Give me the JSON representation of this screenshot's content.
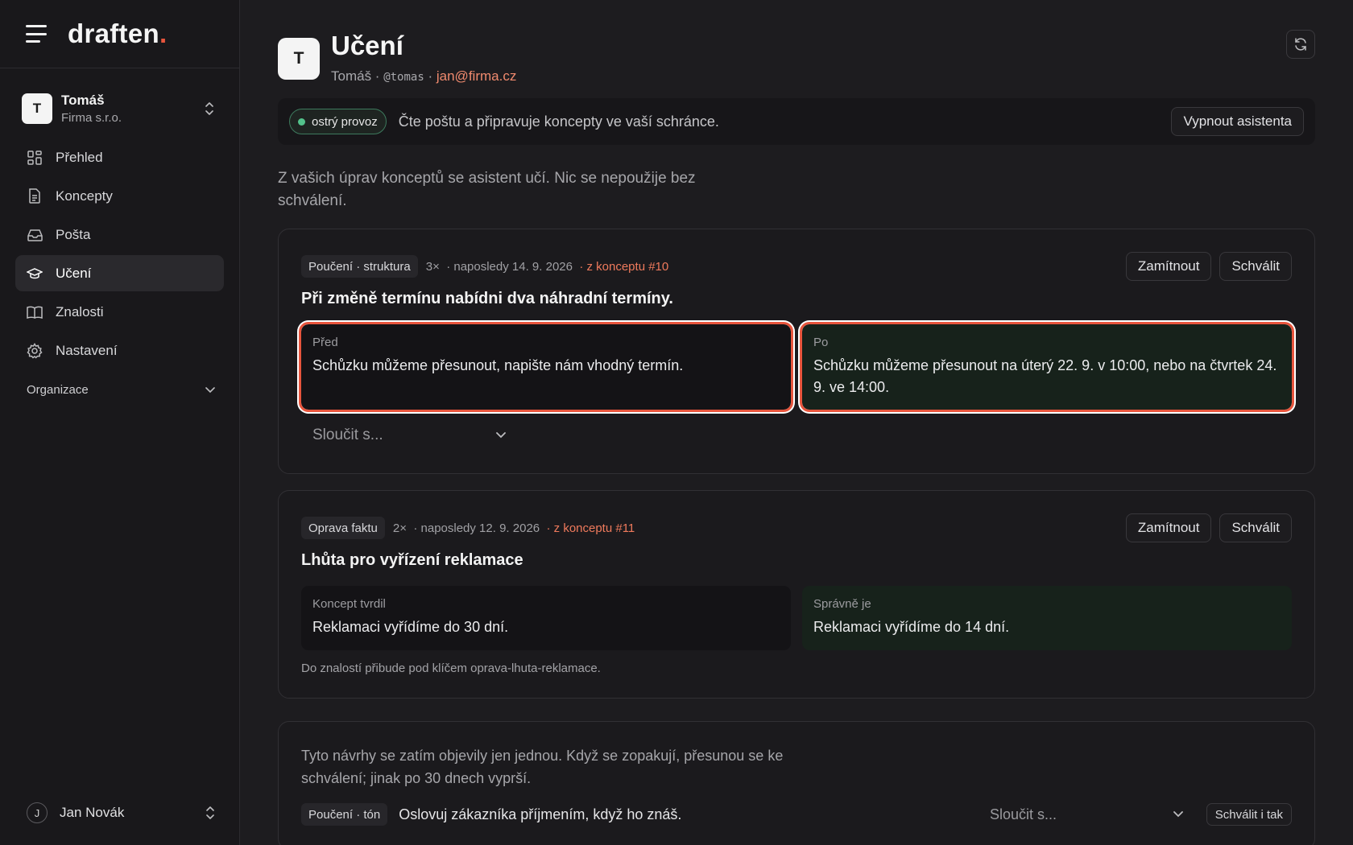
{
  "brand": {
    "name": "draften",
    "dot": "."
  },
  "workspace": {
    "initial": "T",
    "name": "Tomáš",
    "org": "Firma s.r.o."
  },
  "nav": [
    {
      "label": "Přehled",
      "icon": "dashboard-icon"
    },
    {
      "label": "Koncepty",
      "icon": "document-icon"
    },
    {
      "label": "Pošta",
      "icon": "inbox-icon"
    },
    {
      "label": "Učení",
      "icon": "graduation-cap-icon",
      "active": true
    },
    {
      "label": "Znalosti",
      "icon": "book-icon"
    },
    {
      "label": "Nastavení",
      "icon": "gear-icon"
    }
  ],
  "org_section": "Organizace",
  "user": {
    "initial": "J",
    "name": "Jan Novák"
  },
  "page": {
    "initial": "T",
    "title": "Učení",
    "name": "Tomáš",
    "handle": "@tomas",
    "email": "jan@firma.cz"
  },
  "status": {
    "pill": "ostrý provoz",
    "text": "Čte poštu a připravuje koncepty ve vaší schránce.",
    "button": "Vypnout asistenta"
  },
  "intro": "Z vašich úprav konceptů se asistent učí. Nic se nepoužije bez schválení.",
  "cards": [
    {
      "tag": "Poučení · struktura",
      "count": "3×",
      "last": "· naposledy 14. 9. 2026",
      "source": "· z konceptu #10",
      "title": "Při změně termínu nabídni dva náhradní termíny.",
      "left_label": "Před",
      "left_text": "Schůzku můžeme přesunout, napište nám vhodný termín.",
      "right_label": "Po",
      "right_text": "Schůzku můžeme přesunout na úterý 22. 9. v 10:00, nebo na čtvrtek 24. 9. ve 14:00.",
      "merge": "Sloučit s...",
      "reject": "Zamítnout",
      "approve": "Schválit"
    },
    {
      "tag": "Oprava faktu",
      "count": "2×",
      "last": "· naposledy 12. 9. 2026",
      "source": "· z konceptu #11",
      "title": "Lhůta pro vyřízení reklamace",
      "left_label": "Koncept tvrdil",
      "left_text": "Reklamaci vyřídíme do 30 dní.",
      "right_label": "Správně je",
      "right_text": "Reklamaci vyřídíme do 14 dní.",
      "note": "Do znalostí přibude pod klíčem oprava-lhuta-reklamace.",
      "reject": "Zamítnout",
      "approve": "Schválit"
    }
  ],
  "pending": {
    "text": "Tyto návrhy se zatím objevily jen jednou. Když se zopakují, přesunou se ke schválení; jinak po 30 dnech vyprší.",
    "tag": "Poučení · tón",
    "rule": "Oslovuj zákazníka příjmením, když ho znáš.",
    "merge": "Sloučit s...",
    "approve": "Schválit i tak"
  },
  "colors": {
    "accent": "#e8553d",
    "live": "#53c28b",
    "link": "#ef7a5c"
  }
}
